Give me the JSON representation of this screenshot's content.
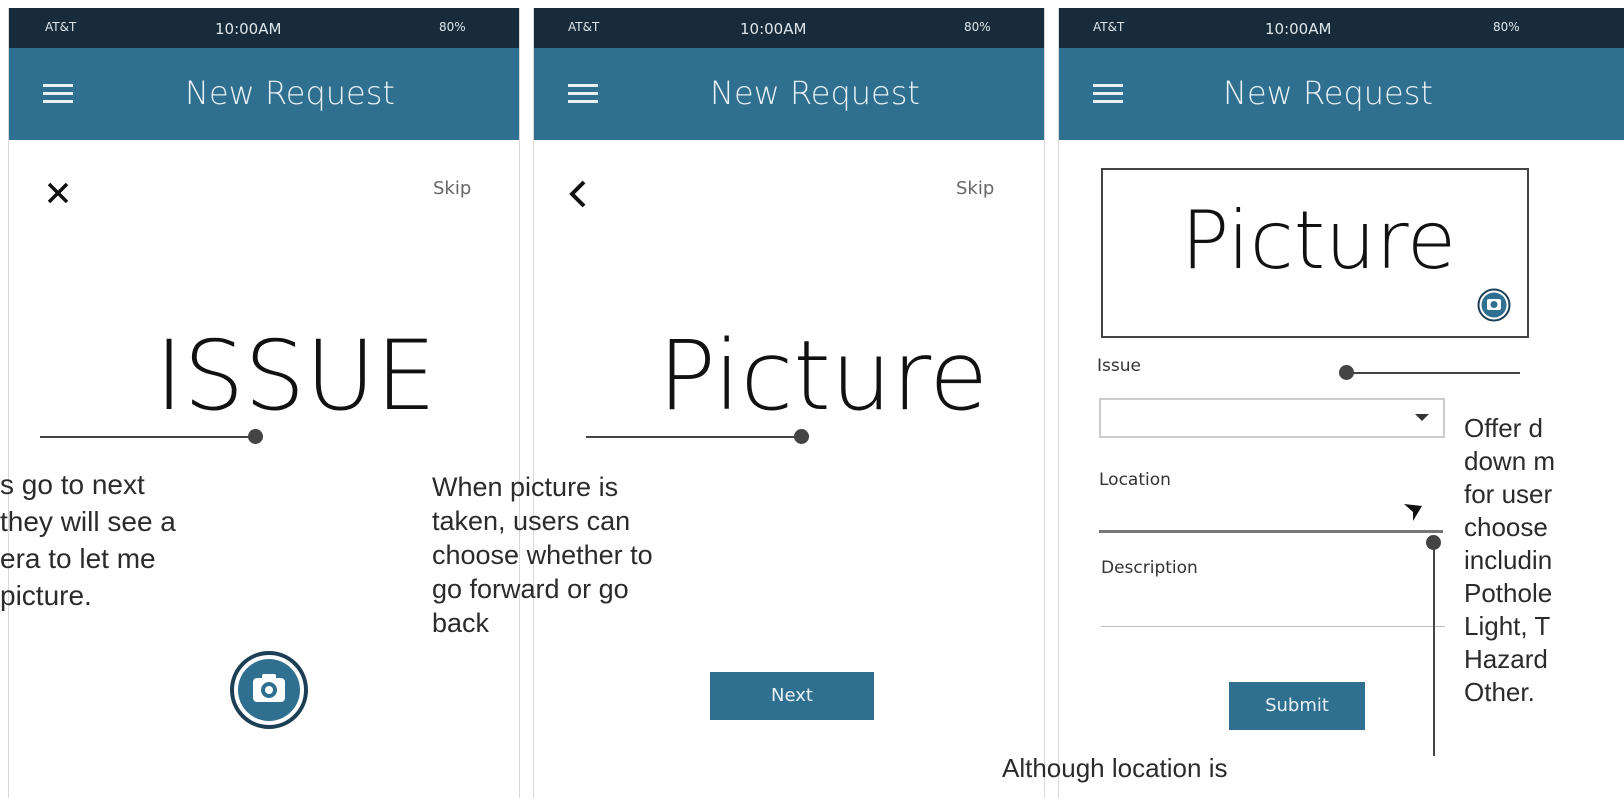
{
  "status_bar": {
    "carrier": "AT&T",
    "time": "10:00AM",
    "battery": "80%"
  },
  "screens": [
    {
      "header_title": "New Request",
      "nav_icon": "close-icon",
      "skip_label": "Skip",
      "heading": "ISSUE",
      "action_icon": "camera-icon"
    },
    {
      "header_title": "New Request",
      "nav_icon": "back-chevron-icon",
      "skip_label": "Skip",
      "heading": "Picture",
      "next_label": "Next"
    },
    {
      "header_title": "New Request",
      "picture_placeholder": "Picture",
      "form": {
        "issue_label": "Issue",
        "issue_value": "",
        "location_label": "Location",
        "location_value": "",
        "description_label": "Description",
        "description_value": ""
      },
      "submit_label": "Submit"
    }
  ],
  "annotations": {
    "issue_note": [
      "s go to next",
      "they will see a",
      "era to let me",
      "picture."
    ],
    "picture_note": [
      "When picture is",
      "taken, users can",
      "choose whether to",
      "go forward or go",
      "back"
    ],
    "dropdown_note": [
      "Offer d",
      "down m",
      "for user",
      "choose",
      "includin",
      "Pothole",
      "Light, T",
      "Hazard",
      "Other."
    ],
    "location_note": "Although location is"
  }
}
